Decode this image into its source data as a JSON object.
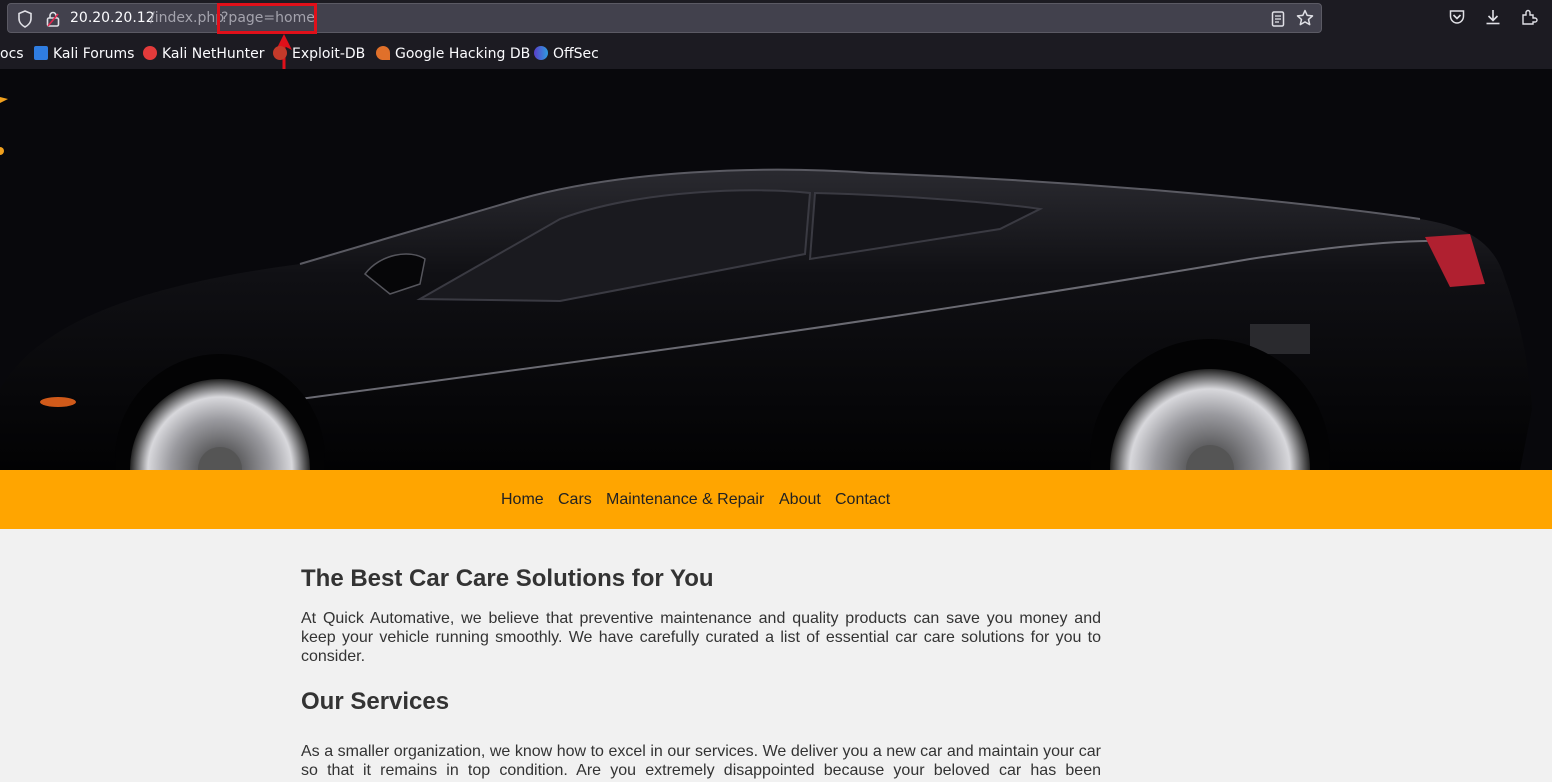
{
  "browser": {
    "url_host": "20.20.20.12",
    "url_path": "/index.php",
    "url_query": "?page=home"
  },
  "bookmarks": [
    {
      "label": "ocs",
      "icon": "docs-icon"
    },
    {
      "label": "Kali Forums",
      "icon": "kali-forums-icon"
    },
    {
      "label": "Kali NetHunter",
      "icon": "kali-nethunter-icon"
    },
    {
      "label": "Exploit-DB",
      "icon": "exploit-db-icon"
    },
    {
      "label": "Google Hacking DB",
      "icon": "ghdb-icon"
    },
    {
      "label": "OffSec",
      "icon": "offsec-icon"
    }
  ],
  "nav": {
    "items": [
      "Home",
      "Cars",
      "Maintenance & Repair",
      "About",
      "Contact"
    ]
  },
  "content": {
    "heading1": "The Best Car Care Solutions for You",
    "para1": "At Quick Automative, we believe that preventive maintenance and quality products can save you money and keep your vehicle running smoothly. We have carefully curated a list of essential car care solutions for you to consider.",
    "heading2": "Our Services",
    "para2": "As a smaller organization, we know how to excel in our services. We deliver you a new car and maintain your car so that it remains in top condition. Are you extremely disappointed because your beloved car has been damaged? Then we can repair it and it will look like new again. Do you have wild ideas? We are ready for you to"
  },
  "colors": {
    "nav_bg": "#ffa500",
    "annotation": "#e0101a"
  }
}
